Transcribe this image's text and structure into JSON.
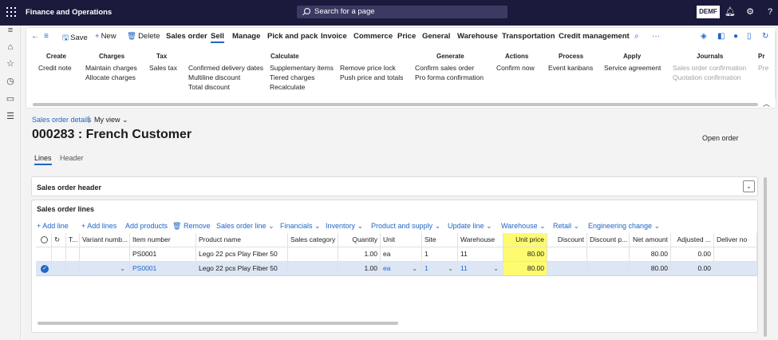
{
  "topbar": {
    "app_title": "Finance and Operations",
    "search_placeholder": "Search for a page",
    "company": "DEMF",
    "icons": [
      "waffle-icon",
      "bell-icon",
      "gear-icon",
      "help-icon"
    ]
  },
  "leftnav": {
    "icons": [
      "hamburger-icon",
      "home-icon",
      "star-icon",
      "clock-icon",
      "workspace-icon",
      "list-icon"
    ]
  },
  "actionpane": {
    "save": "Save",
    "new": "New",
    "delete": "Delete",
    "tabs": [
      "Sales order",
      "Sell",
      "Manage",
      "Pick and pack",
      "Invoice",
      "Commerce",
      "Price",
      "General",
      "Warehouse",
      "Transportation",
      "Credit management"
    ],
    "active_tab": "Sell",
    "groups": [
      {
        "title": "Create",
        "items": [
          "Credit note"
        ]
      },
      {
        "title": "Charges",
        "items": [
          "Maintain charges",
          "Allocate charges"
        ]
      },
      {
        "title": "Tax",
        "items": [
          "Sales tax"
        ]
      },
      {
        "title": "Calculate",
        "items": [
          "Confirmed delivery dates",
          "Multiline discount",
          "Total discount",
          "Supplementary items",
          "Tiered charges",
          "Recalculate",
          "Remove price lock",
          "Push price and totals"
        ]
      },
      {
        "title": "Generate",
        "items": [
          "Confirm sales order",
          "Pro forma confirmation"
        ]
      },
      {
        "title": "Actions",
        "items": [
          "Confirm now"
        ]
      },
      {
        "title": "Process",
        "items": [
          "Event kanbans"
        ]
      },
      {
        "title": "Apply",
        "items": [
          "Service agreement"
        ]
      },
      {
        "title": "Journals",
        "items": [
          "Sales order confirmation",
          "Quotation confirmation"
        ]
      },
      {
        "title": "Pr",
        "items": [
          "Pre"
        ]
      }
    ]
  },
  "page": {
    "breadcrumb": "Sales order details",
    "view": "My view",
    "title": "000283 : French Customer",
    "status": "Open order",
    "tabs": [
      "Lines",
      "Header"
    ]
  },
  "header_fasttab": "Sales order header",
  "lines_fasttab": "Sales order lines",
  "grid_toolbar": [
    "Add line",
    "Add lines",
    "Add products",
    "Remove",
    "Sales order line",
    "Financials",
    "Inventory",
    "Product and supply",
    "Update line",
    "Warehouse",
    "Retail",
    "Engineering change"
  ],
  "grid": {
    "columns": [
      "T...",
      "Variant numb...",
      "Item number",
      "Product name",
      "Sales category",
      "Quantity",
      "Unit",
      "Site",
      "Warehouse",
      "Unit price",
      "Discount",
      "Discount p...",
      "Net amount",
      "Adjusted ...",
      "Deliver no"
    ],
    "rows": [
      {
        "item": "PS0001",
        "product": "Lego 22 pcs Play Fiber 50",
        "qty": "1.00",
        "unit": "ea",
        "site": "1",
        "warehouse": "11",
        "price": "80.00",
        "net": "80.00",
        "adjusted": "0.00"
      },
      {
        "item": "PS0001",
        "product": "Lego 22 pcs Play Fiber 50",
        "qty": "1.00",
        "unit": "ea",
        "site": "1",
        "warehouse": "11",
        "price": "80.00",
        "net": "80.00",
        "adjusted": "0.00"
      }
    ]
  },
  "colors": {
    "topbar": "#1b1a3d",
    "accent": "#2266c4",
    "highlight": "#fffb70",
    "selected_row": "#dde6f5"
  }
}
